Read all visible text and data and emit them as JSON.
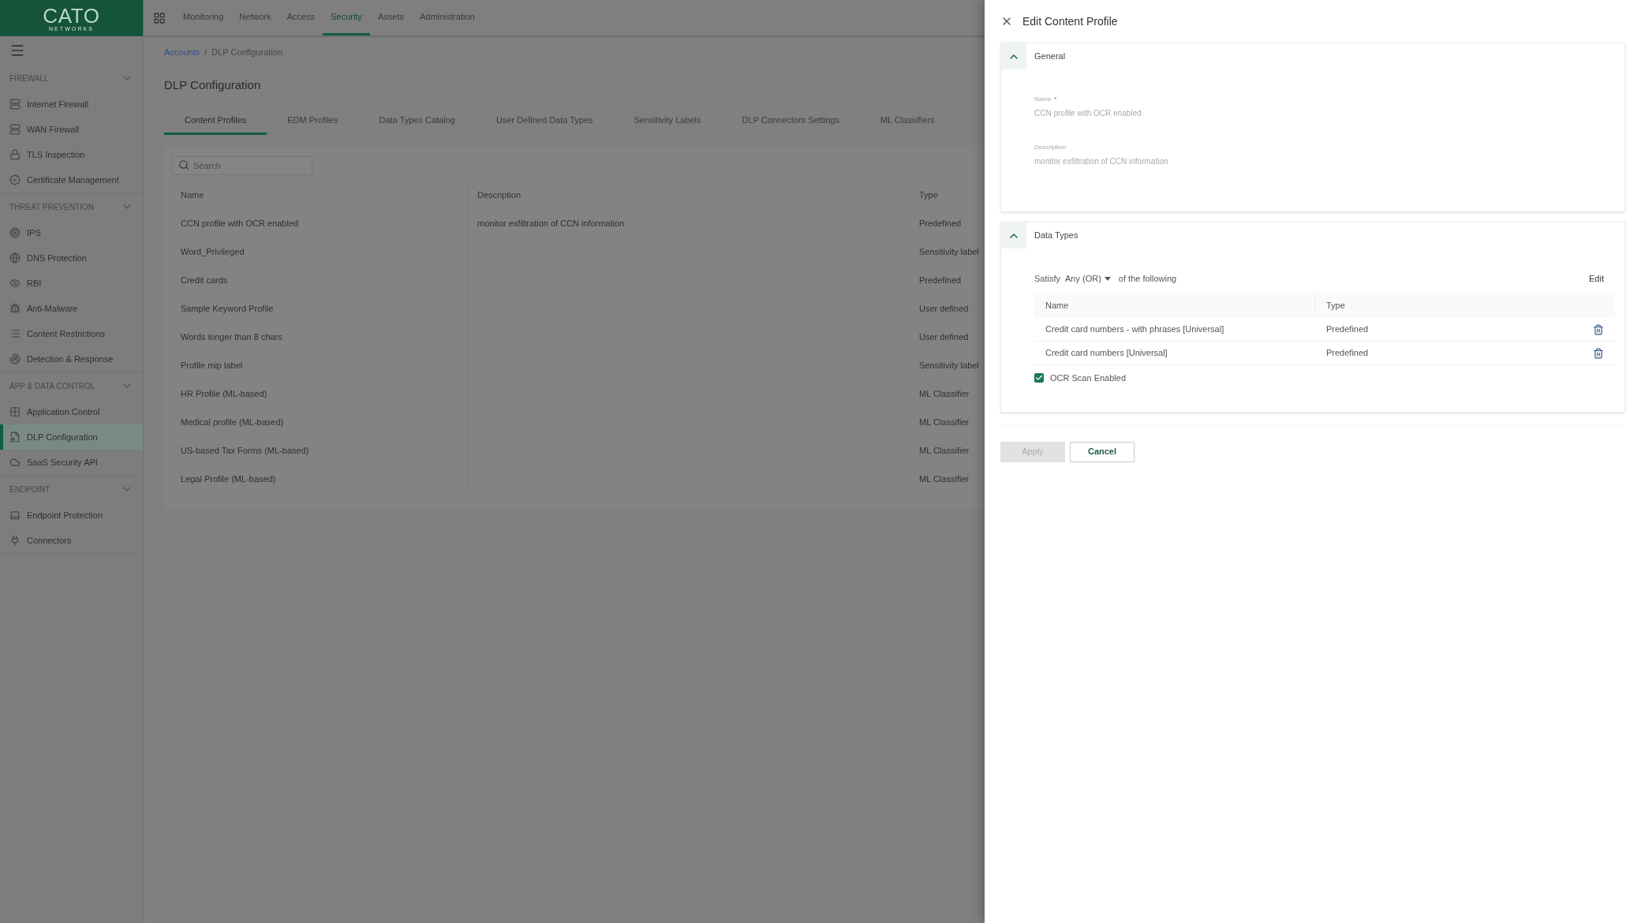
{
  "logo": {
    "name": "CATO",
    "tagline": "NETWORKS"
  },
  "top_nav": [
    {
      "label": "Monitoring",
      "selected": false
    },
    {
      "label": "Network",
      "selected": false
    },
    {
      "label": "Access",
      "selected": false
    },
    {
      "label": "Security",
      "selected": true
    },
    {
      "label": "Assets",
      "selected": false
    },
    {
      "label": "Administration",
      "selected": false
    }
  ],
  "sidebar": {
    "sections": [
      {
        "title": "FIREWALL",
        "expanded": true,
        "items": [
          {
            "label": "Internet Firewall",
            "selected": false
          },
          {
            "label": "WAN Firewall",
            "selected": false
          },
          {
            "label": "TLS Inspection",
            "selected": false
          },
          {
            "label": "Certificate Management",
            "selected": false
          }
        ]
      },
      {
        "title": "THREAT PREVENTION",
        "expanded": true,
        "items": [
          {
            "label": "IPS",
            "selected": false
          },
          {
            "label": "DNS Protection",
            "selected": false
          },
          {
            "label": "RBI",
            "selected": false
          },
          {
            "label": "Anti-Malware",
            "selected": false
          },
          {
            "label": "Content Restrictions",
            "selected": false
          },
          {
            "label": "Detection & Response",
            "selected": false
          }
        ]
      },
      {
        "title": "APP & DATA CONTROL",
        "expanded": true,
        "items": [
          {
            "label": "Application Control",
            "selected": false
          },
          {
            "label": "DLP Configuration",
            "selected": true
          },
          {
            "label": "SaaS Security API",
            "selected": false
          }
        ]
      },
      {
        "title": "ENDPOINT",
        "expanded": true,
        "items": [
          {
            "label": "Endpoint Protection",
            "selected": false
          },
          {
            "label": "Connectors",
            "selected": false
          }
        ]
      }
    ]
  },
  "breadcrumb": [
    {
      "label": "Accounts",
      "kind": "link"
    },
    {
      "label": "/",
      "kind": "separator"
    },
    {
      "label": "DLP Configuration",
      "kind": "current"
    }
  ],
  "page_title": "DLP Configuration",
  "tabs": [
    {
      "label": "Content Profiles",
      "selected": true
    },
    {
      "label": "EDM Profiles",
      "selected": false
    },
    {
      "label": "Data Types Catalog",
      "selected": false
    },
    {
      "label": "User Defined Data Types",
      "selected": false
    },
    {
      "label": "Sensitivity Labels",
      "selected": false
    },
    {
      "label": "DLP Connectors Settings",
      "selected": false
    },
    {
      "label": "ML Classifiers",
      "selected": false
    }
  ],
  "search": {
    "placeholder": "Search"
  },
  "table": {
    "columns": [
      "Name",
      "Description",
      "Type"
    ],
    "rows": [
      [
        "CCN profile with OCR enabled",
        "monitor exfiltration of CCN information",
        "Predefined"
      ],
      [
        "Word_Privileged",
        "",
        "Sensitivity label"
      ],
      [
        "Credit cards",
        "",
        "Predefined"
      ],
      [
        "Sample Keyword Profile",
        "",
        "User defined"
      ],
      [
        "Words longer than 8 chars",
        "",
        "User defined"
      ],
      [
        "Profile mip label",
        "",
        "Sensitivity label"
      ],
      [
        "HR Profile (ML-based)",
        "",
        "ML Classifier"
      ],
      [
        "Medical profile (ML-based)",
        "",
        "ML Classifier"
      ],
      [
        "US-based Tax Forms (ML-based)",
        "",
        "ML Classifier"
      ],
      [
        "Legal Profile (ML-based)",
        "",
        "ML Classifier"
      ]
    ]
  },
  "panel": {
    "title": "Edit Content Profile",
    "general": {
      "title": "General",
      "expanded": true,
      "fields": [
        {
          "label": "Name",
          "required_mark": "*",
          "value": "CCN profile with OCR enabled"
        },
        {
          "label": "Description",
          "value": "monitor exfiltration of CCN information"
        }
      ]
    },
    "data_types": {
      "title": "Data Types",
      "expanded": true,
      "satisfy_label": "Satisfy",
      "satisfy_value": "Any (OR)",
      "satisfy_suffix": "of the following",
      "edit": "Edit",
      "columns": [
        "Name",
        "Type"
      ],
      "rows": [
        [
          "Credit card numbers - with phrases [Universal]",
          "Predefined"
        ],
        [
          "Credit card numbers [Universal]",
          "Predefined"
        ]
      ],
      "ocr": {
        "label": "OCR Scan Enabled",
        "checked": true
      }
    },
    "buttons": [
      {
        "label": "Apply",
        "kind": "primary",
        "disabled": true
      },
      {
        "label": "Cancel",
        "kind": "secondary",
        "disabled": false
      }
    ]
  }
}
